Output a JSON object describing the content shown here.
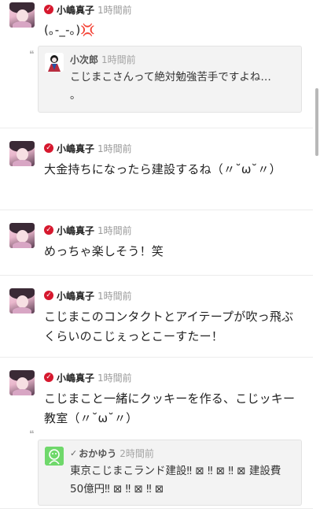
{
  "posts": [
    {
      "name": "小嶋真子",
      "time": "1時間前",
      "text": "(｡-_-｡)💢",
      "quote": {
        "name": "小次郎",
        "time": "1時間前",
        "text": "こじまこさんって絶対勉強苦手ですよね…\n。"
      }
    },
    {
      "name": "小嶋真子",
      "time": "1時間前",
      "text": "大金持ちになったら建設するね（〃˘ω˘〃）"
    },
    {
      "name": "小嶋真子",
      "time": "1時間前",
      "text": "めっちゃ楽しそう！笑"
    },
    {
      "name": "小嶋真子",
      "time": "1時間前",
      "text": "こじまこのコンタクトとアイテープが吹っ飛ぶくらいのこじぇっとこーすたー！"
    },
    {
      "name": "小嶋真子",
      "time": "1時間前",
      "text": "こじまこと一緒にクッキーを作る、こじッキー教室（〃˘ω˘〃）",
      "quote": {
        "name": "おかゆう",
        "time": "2時間前",
        "text": "東京こじまこランド建設‼︎ ⊠ ‼︎ ⊠ ‼︎ ⊠ 建設費50億円‼︎ ⊠ ‼︎ ⊠ ‼︎ ⊠"
      }
    }
  ],
  "colors": {
    "badge": "#d6182e",
    "time": "#9a9a9a",
    "quote_bg": "#f3f3f3"
  }
}
